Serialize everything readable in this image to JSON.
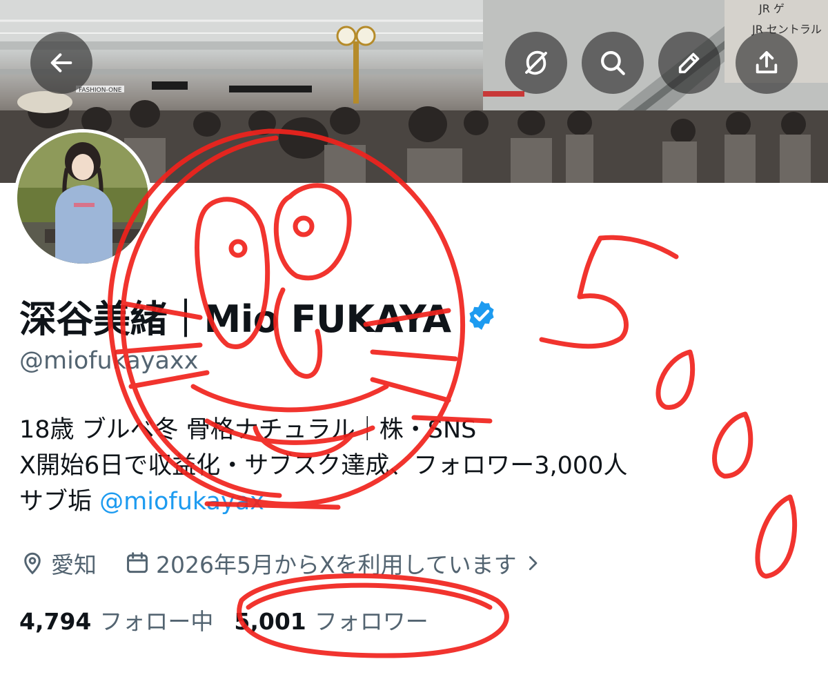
{
  "banner": {
    "signs": [
      "JR ゲ",
      "JR セントラル",
      "FASHION-ONE"
    ]
  },
  "header_buttons": {
    "back_icon": "arrow-left-icon",
    "grok_icon": "grok-icon",
    "search_icon": "search-icon",
    "edit_icon": "pencil-icon",
    "share_icon": "share-upload-icon"
  },
  "profile": {
    "name": "深谷美緒｜Mio FUKAYA",
    "verified": true,
    "verified_color": "#1d9bf0",
    "handle": "@miofukayaxx",
    "bio": {
      "line1": "18歳 ブルベ冬 骨格ナチュラル｜株・SNS",
      "line2": "X開始6日で収益化・サブスク達成、フォロワー3,000人",
      "line3_prefix": "サブ垢 ",
      "line3_mention": "@miofukayax"
    },
    "location": "愛知",
    "joined": "2026年5月からXを利用しています",
    "following_count": "4,794",
    "following_label": "フォロー中",
    "followers_count": "5,001",
    "followers_label": "フォロワー"
  },
  "colors": {
    "text_primary": "#0f1419",
    "text_secondary": "#536471",
    "accent": "#1d9bf0",
    "scribble": "#f0231d"
  }
}
